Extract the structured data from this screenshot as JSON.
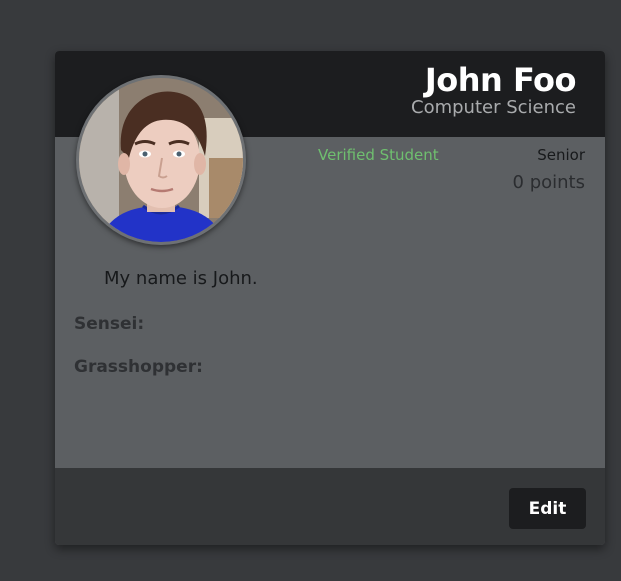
{
  "profile": {
    "name": "John Foo",
    "major": "Computer Science",
    "verified_label": "Verified Student",
    "year": "Senior",
    "points": "0 points",
    "bio": "My name is John.",
    "sensei_label": "Sensei:",
    "grasshopper_label": "Grasshopper:"
  },
  "footer": {
    "edit_label": "Edit"
  },
  "colors": {
    "page_background": "#383a3d",
    "header_background": "#1c1d1f",
    "card_body": "#5c5f62",
    "footer_background": "#353739",
    "verified_green": "#6fbf6f",
    "button_background": "#1c1d1f"
  }
}
